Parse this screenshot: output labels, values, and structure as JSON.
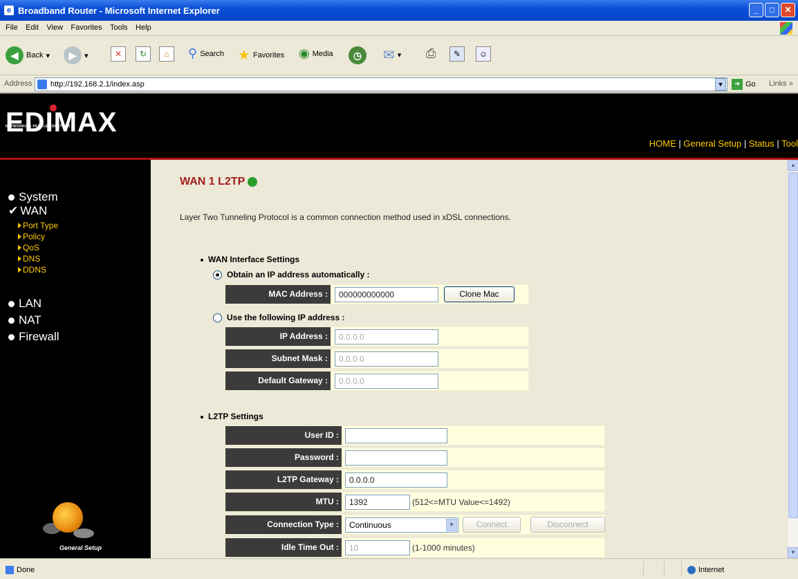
{
  "window": {
    "title": "Broadband Router - Microsoft Internet Explorer"
  },
  "menu": [
    "File",
    "Edit",
    "View",
    "Favorites",
    "Tools",
    "Help"
  ],
  "toolbar": {
    "back": "Back",
    "search": "Search",
    "favorites": "Favorites",
    "media": "Media"
  },
  "address": {
    "label": "Address",
    "url": "http://192.168.2.1/index.asp",
    "go": "Go",
    "links": "Links »"
  },
  "brand": {
    "logo": "EDIMAX",
    "tagline": "NETWORKING PEOPLE TOGETHER"
  },
  "topnav": [
    "HOME",
    "General Setup",
    "Status",
    "Tool"
  ],
  "sidebar": {
    "items": [
      "System",
      "WAN",
      "LAN",
      "NAT",
      "Firewall"
    ],
    "wan_sub": [
      "Port Type",
      "Policy",
      "QoS",
      "DNS",
      "DDNS"
    ],
    "footer": "General Setup"
  },
  "page": {
    "title": "WAN 1 L2TP",
    "description": "Layer Two Tunneling Protocol is a common connection method used in xDSL connections.",
    "wan_section": "WAN Interface Settings",
    "obtain_auto": "Obtain an IP address automatically :",
    "use_following": "Use the following IP address :",
    "mac": {
      "label": "MAC Address :",
      "value": "000000000000",
      "button": "Clone Mac"
    },
    "ip": {
      "label": "IP Address :",
      "value": "0.0.0.0"
    },
    "subnet": {
      "label": "Subnet Mask :",
      "value": "0.0.0.0"
    },
    "gateway": {
      "label": "Default Gateway :",
      "value": "0.0.0.0"
    },
    "l2tp_section": "L2TP Settings",
    "userid": {
      "label": "User ID :",
      "value": ""
    },
    "password": {
      "label": "Password :",
      "value": ""
    },
    "l2tp_gateway": {
      "label": "L2TP Gateway :",
      "value": "0.0.0.0"
    },
    "mtu": {
      "label": "MTU :",
      "value": "1392",
      "note": "(512<=MTU Value<=1492)"
    },
    "conn_type": {
      "label": "Connection Type :",
      "value": "Continuous",
      "connect": "Connect",
      "disconnect": "Disconnect"
    },
    "idle": {
      "label": "Idle Time Out :",
      "value": "10",
      "note": "(1-1000 minutes)"
    }
  },
  "status": {
    "left": "Done",
    "zone": "Internet"
  },
  "colors": {
    "title_red": "#a51e1e",
    "nav_yellow": "#ffcc00",
    "label_bg": "#3b3b3b",
    "row_bg": "#ffffe0"
  }
}
